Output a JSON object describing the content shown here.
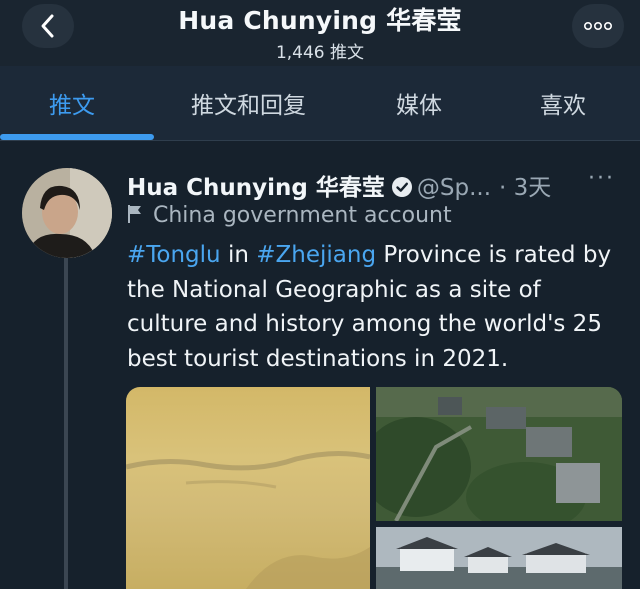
{
  "header": {
    "title": "Hua Chunying 华春莹",
    "subtitle": "1,446 推文"
  },
  "tabs": [
    {
      "label": "推文",
      "active": true
    },
    {
      "label": "推文和回复",
      "active": false
    },
    {
      "label": "媒体",
      "active": false
    },
    {
      "label": "喜欢",
      "active": false
    }
  ],
  "tweet": {
    "author_name": "Hua Chunying 华春莹",
    "handle": "@Sp...",
    "time": "· 3天",
    "account_label": "China government account",
    "text_lines": [
      [
        {
          "t": "#Tonglu",
          "h": true
        },
        {
          "t": " in ",
          "h": false
        },
        {
          "t": "#Zhejiang",
          "h": true
        },
        {
          "t": " Province is rated by",
          "h": false
        }
      ],
      [
        {
          "t": "the National Geographic as a site of",
          "h": false
        }
      ],
      [
        {
          "t": "culture and history among the world's 25",
          "h": false
        }
      ],
      [
        {
          "t": "best tourist destinations in 2021.",
          "h": false
        }
      ]
    ]
  },
  "colors": {
    "background": "#15202b",
    "accent": "#3d9bef",
    "hashtag": "#4aa6f0",
    "muted": "#9aa8b4"
  },
  "icons": {
    "back": "chevron-left-icon",
    "more": "more-dots-icon",
    "verified": "verified-badge-icon",
    "flag": "flag-icon"
  }
}
